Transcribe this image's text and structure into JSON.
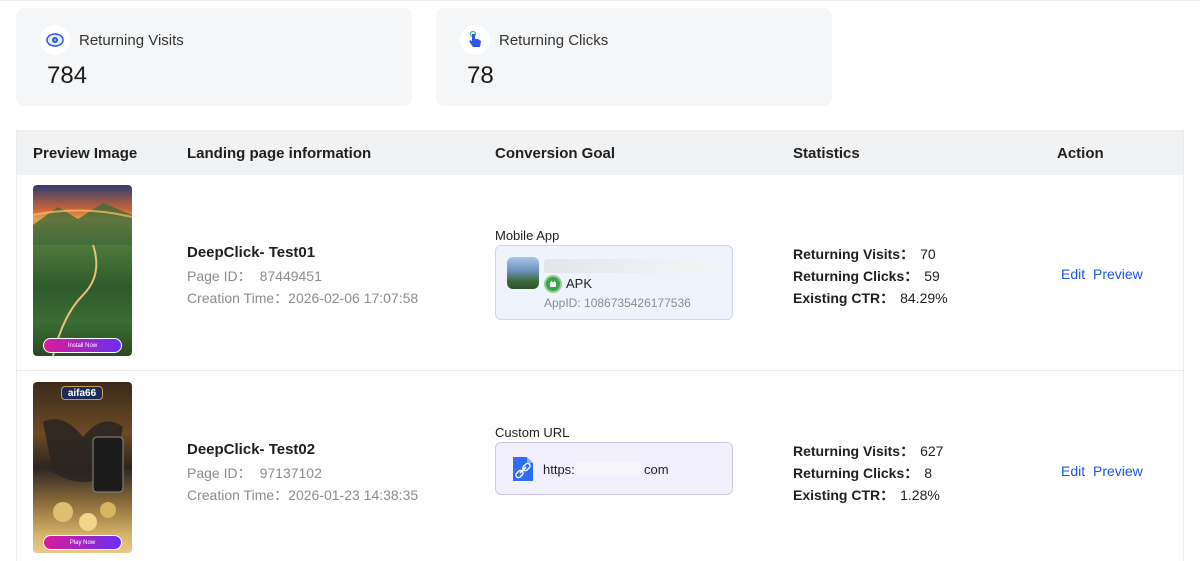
{
  "stats": {
    "returning_visits": {
      "label": "Returning Visits",
      "value": "784",
      "icon": "eye-icon",
      "color": "#2f54eb"
    },
    "returning_clicks": {
      "label": "Returning Clicks",
      "value": "78",
      "icon": "tap-hand-icon",
      "color": "#2f54eb"
    }
  },
  "table": {
    "columns": [
      "Preview Image",
      "Landing page information",
      "Conversion Goal",
      "Statistics",
      "Action"
    ],
    "rows": [
      {
        "preview_cta": "Install Now",
        "title": "DeepClick- Test01",
        "page_id_label": "Page ID：",
        "page_id": "87449451",
        "creation_label": "Creation Time：",
        "creation_time": "2026-02-06 17:07:58",
        "goal_type": "Mobile App",
        "apk_label": "APK",
        "app_id": "AppID: 1086735426177536",
        "stat_visits_label": "Returning Visits：",
        "stat_visits": "70",
        "stat_clicks_label": "Returning Clicks：",
        "stat_clicks": "59",
        "stat_ctr_label": "Existing CTR：",
        "stat_ctr": "84.29%",
        "edit": "Edit",
        "preview": "Preview"
      },
      {
        "preview_brand": "aifa66",
        "preview_cta": "Play Now",
        "title": "DeepClick- Test02",
        "page_id_label": "Page ID：",
        "page_id": "97137102",
        "creation_label": "Creation Time：",
        "creation_time": "2026-01-23 14:38:35",
        "goal_type": "Custom URL",
        "url_prefix": "https:",
        "url_suffix": "com",
        "stat_visits_label": "Returning Visits：",
        "stat_visits": "627",
        "stat_clicks_label": "Returning Clicks：",
        "stat_clicks": "8",
        "stat_ctr_label": "Existing CTR：",
        "stat_ctr": "1.28%",
        "edit": "Edit",
        "preview": "Preview"
      }
    ]
  },
  "colors": {
    "link": "#1a56e6",
    "header_bg": "#f1f2f3",
    "card_bg": "#f5f6f7"
  }
}
